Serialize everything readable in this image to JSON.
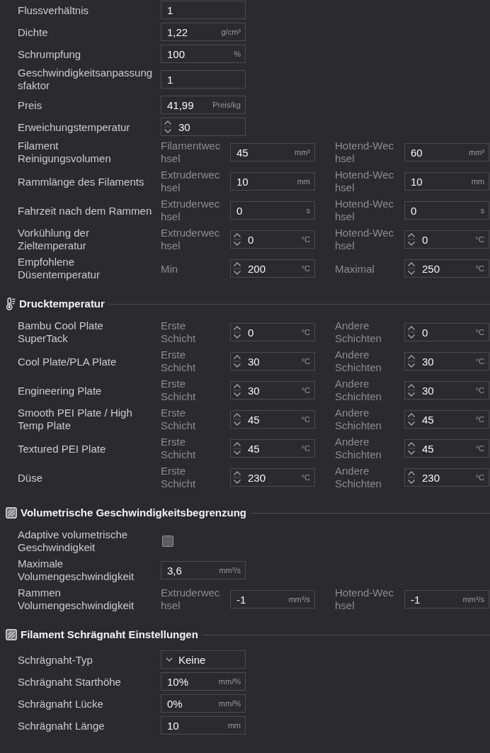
{
  "groups": [
    {
      "rows": [
        {
          "kind": "single",
          "label": "Flussverhältnis",
          "field": {
            "kind": "text",
            "value": "1"
          }
        },
        {
          "kind": "single",
          "label": "Dichte",
          "field": {
            "kind": "text",
            "value": "1,22",
            "unit": "g/cm³"
          }
        },
        {
          "kind": "single",
          "label": "Schrumpfung",
          "field": {
            "kind": "text",
            "value": "100",
            "unit": "%"
          }
        },
        {
          "kind": "single",
          "label": "Geschwindigkeitsanpassung\nsfaktor",
          "field": {
            "kind": "text",
            "value": "1"
          }
        },
        {
          "kind": "single",
          "label": "Preis",
          "field": {
            "kind": "text",
            "value": "41,99",
            "unit": "Preis/kg"
          }
        },
        {
          "kind": "single",
          "label": "Erweichungstemperatur",
          "field": {
            "kind": "spin",
            "value": "30"
          }
        },
        {
          "kind": "pair",
          "label": "Filament Reinigungsvolumen",
          "fields": [
            {
              "sublabel": "Filamentwec\nhsel",
              "kind": "text",
              "value": "45",
              "unit": "mm³"
            },
            {
              "sublabel": "Hotend-Wec\nhsel",
              "kind": "text",
              "value": "60",
              "unit": "mm³"
            }
          ]
        },
        {
          "kind": "pair",
          "label": "Rammlänge des Filaments",
          "fields": [
            {
              "sublabel": "Extruderwec\nhsel",
              "kind": "text",
              "value": "10",
              "unit": "mm"
            },
            {
              "sublabel": "Hotend-Wec\nhsel",
              "kind": "text",
              "value": "10",
              "unit": "mm"
            }
          ]
        },
        {
          "kind": "pair",
          "label": "Fahrzeit nach dem Rammen",
          "fields": [
            {
              "sublabel": "Extruderwec\nhsel",
              "kind": "text",
              "value": "0",
              "unit": "s"
            },
            {
              "sublabel": "Hotend-Wec\nhsel",
              "kind": "text",
              "value": "0",
              "unit": "s"
            }
          ]
        },
        {
          "kind": "pair",
          "label": "Vorkühlung der Zieltemperatur",
          "fields": [
            {
              "sublabel": "Extruderwec\nhsel",
              "kind": "spin",
              "value": "0",
              "unit": "°C"
            },
            {
              "sublabel": "Hotend-Wec\nhsel",
              "kind": "spin",
              "value": "0",
              "unit": "°C"
            }
          ]
        },
        {
          "kind": "pair",
          "label": "Empfohlene Düsentemperatur",
          "fields": [
            {
              "sublabel": "Min",
              "kind": "spin",
              "value": "200",
              "unit": "°C"
            },
            {
              "sublabel": "Maximal",
              "kind": "spin",
              "value": "250",
              "unit": "°C"
            }
          ]
        }
      ]
    },
    {
      "title": "Drucktemperatur",
      "kind": "temperature",
      "rows": [
        {
          "kind": "pair",
          "label": "Bambu Cool Plate SuperTack",
          "fields": [
            {
              "sublabel": "Erste Schicht",
              "kind": "spin",
              "value": "0",
              "unit": "°C"
            },
            {
              "sublabel": "Andere Schichten",
              "kind": "spin",
              "value": "0",
              "unit": "°C"
            }
          ]
        },
        {
          "kind": "pair",
          "label": "Cool Plate/PLA Plate",
          "fields": [
            {
              "sublabel": "Erste Schicht",
              "kind": "spin",
              "value": "30",
              "unit": "°C"
            },
            {
              "sublabel": "Andere Schichten",
              "kind": "spin",
              "value": "30",
              "unit": "°C"
            }
          ]
        },
        {
          "kind": "pair",
          "label": "Engineering Plate",
          "fields": [
            {
              "sublabel": "Erste Schicht",
              "kind": "spin",
              "value": "30",
              "unit": "°C"
            },
            {
              "sublabel": "Andere Schichten",
              "kind": "spin",
              "value": "30",
              "unit": "°C"
            }
          ]
        },
        {
          "kind": "pair",
          "label": "Smooth PEI Plate / High Temp Plate",
          "fields": [
            {
              "sublabel": "Erste Schicht",
              "kind": "spin",
              "value": "45",
              "unit": "°C"
            },
            {
              "sublabel": "Andere Schichten",
              "kind": "spin",
              "value": "45",
              "unit": "°C"
            }
          ]
        },
        {
          "kind": "pair",
          "label": "Textured PEI Plate",
          "fields": [
            {
              "sublabel": "Erste Schicht",
              "kind": "spin",
              "value": "45",
              "unit": "°C"
            },
            {
              "sublabel": "Andere Schichten",
              "kind": "spin",
              "value": "45",
              "unit": "°C"
            }
          ]
        },
        {
          "kind": "pair",
          "label": "Düse",
          "fields": [
            {
              "sublabel": "Erste Schicht",
              "kind": "spin",
              "value": "230",
              "unit": "°C"
            },
            {
              "sublabel": "Andere Schichten",
              "kind": "spin",
              "value": "230",
              "unit": "°C"
            }
          ]
        }
      ]
    },
    {
      "title": "Volumetrische Geschwindigkeitsbegrenzung",
      "kind": "general",
      "rows": [
        {
          "kind": "checkbox",
          "label": "Adaptive volumetrische Geschwindigkeit",
          "checked": false
        },
        {
          "kind": "single",
          "label": "Maximale Volumengeschwindigkeit",
          "field": {
            "kind": "text",
            "value": "3,6",
            "unit": "mm³/s"
          }
        },
        {
          "kind": "pair",
          "label": "Rammen Volumengeschwindigkeit",
          "fields": [
            {
              "sublabel": "Extruderwec\nhsel",
              "kind": "text",
              "value": "-1",
              "unit": "mm³/s"
            },
            {
              "sublabel": "Hotend-Wec\nhsel",
              "kind": "text",
              "value": "-1",
              "unit": "mm³/s"
            }
          ]
        }
      ]
    },
    {
      "title": "Filament Schrägnaht Einstellungen",
      "kind": "general",
      "rows": [
        {
          "kind": "single",
          "label": "Schrägnaht-Typ",
          "field": {
            "kind": "select",
            "value": "Keine"
          }
        },
        {
          "kind": "single",
          "label": "Schrägnaht Starthöhe",
          "field": {
            "kind": "text",
            "value": "10%",
            "unit": "mm/%"
          }
        },
        {
          "kind": "single",
          "label": "Schrägnaht Lücke",
          "field": {
            "kind": "text",
            "value": "0%",
            "unit": "mm/%"
          }
        },
        {
          "kind": "single",
          "label": "Schrägnaht Länge",
          "field": {
            "kind": "text",
            "value": "10",
            "unit": "mm"
          }
        }
      ]
    }
  ]
}
